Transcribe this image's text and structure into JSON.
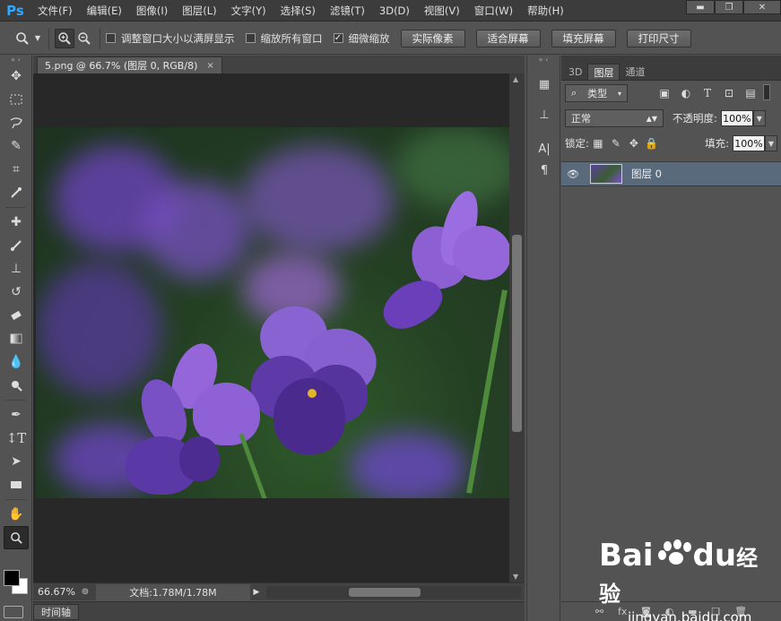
{
  "app": {
    "logo": "Ps",
    "menu": [
      "文件(F)",
      "编辑(E)",
      "图像(I)",
      "图层(L)",
      "文字(Y)",
      "选择(S)",
      "滤镜(T)",
      "3D(D)",
      "视图(V)",
      "窗口(W)",
      "帮助(H)"
    ],
    "window_controls": {
      "minimize": "▬",
      "restore": "❐",
      "close": "✕"
    }
  },
  "options": {
    "checkboxes": [
      {
        "label": "调整窗口大小以满屏显示",
        "checked": false
      },
      {
        "label": "缩放所有窗口",
        "checked": false
      },
      {
        "label": "细微缩放",
        "checked": true
      }
    ],
    "buttons": [
      "实际像素",
      "适合屏幕",
      "填充屏幕",
      "打印尺寸"
    ]
  },
  "document": {
    "tab_title": "5.png @ 66.7% (图层 0, RGB/8)",
    "tab_close": "×",
    "zoom": "66.67%",
    "doc_info": "文档:1.78M/1.78M",
    "timeline_label": "时间轴"
  },
  "panel": {
    "tabs": [
      "3D",
      "图层",
      "通道"
    ],
    "active_tab": "图层",
    "filter_kind": "类型",
    "blend_mode": "正常",
    "opacity_label": "不透明度:",
    "opacity_value": "100%",
    "lock_label": "锁定:",
    "fill_label": "填充:",
    "fill_value": "100%",
    "layers": [
      {
        "name": "图层 0",
        "visible": true
      }
    ]
  },
  "watermark": {
    "logo_left": "Bai",
    "logo_right": "du",
    "logo_cn": "经验",
    "url": "jingyan.baidu.com"
  },
  "colors": {
    "foreground": "#000000",
    "background": "#ffffff",
    "layer_selected": "#596a7d",
    "ps_blue": "#31a8ff"
  }
}
